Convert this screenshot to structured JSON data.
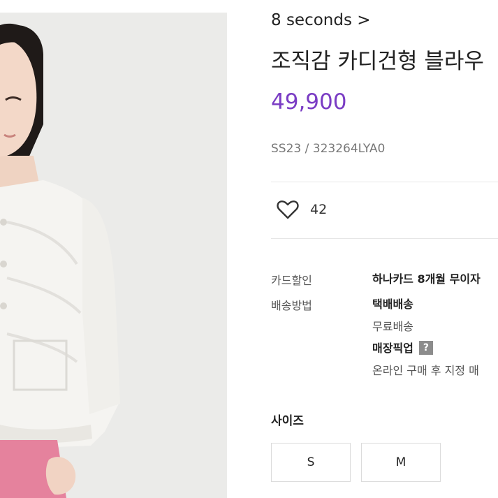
{
  "product": {
    "brand_link": "8 seconds >",
    "title": "조직감 카디건형 블라우",
    "price": "49,900",
    "code": "SS23 / 323264LYA0",
    "likes": "42"
  },
  "info_rows": {
    "card_discount_label": "카드할인",
    "card_discount_value": "하나카드 8개월 무이자",
    "delivery_label": "배송방법",
    "delivery_parcel": "택배배송",
    "delivery_free": "무료배송",
    "store_pickup": "매장픽업",
    "help_icon_glyph": "?",
    "pickup_note": "온라인 구매 후 지정 매"
  },
  "size": {
    "title": "사이즈",
    "options": [
      "S",
      "M"
    ]
  },
  "colors": {
    "price": "#7a3cc4",
    "pants": "#e5829d"
  },
  "icons": {
    "like": "heart-outline-icon",
    "help": "question-icon"
  }
}
